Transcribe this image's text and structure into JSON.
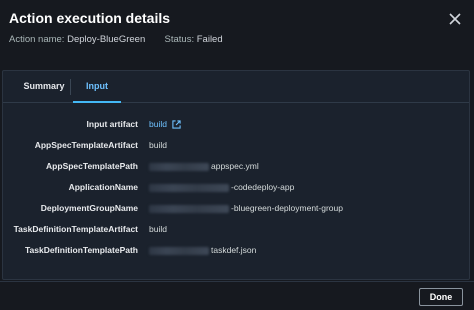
{
  "modal": {
    "title": "Action execution details",
    "action_name_label": "Action name:",
    "action_name_value": "Deploy-BlueGreen",
    "status_label": "Status:",
    "status_value": "Failed"
  },
  "tabs": [
    {
      "label": "Summary",
      "selected": false
    },
    {
      "label": "Input",
      "selected": true
    }
  ],
  "details": [
    {
      "label": "Input artifact",
      "value": "build",
      "link": true
    },
    {
      "label": "AppSpecTemplateArtifact",
      "value": "build"
    },
    {
      "label": "AppSpecTemplatePath",
      "value": "appspec.yml",
      "redacted_prefix": true
    },
    {
      "label": "ApplicationName",
      "value": "-codedeploy-app",
      "redacted_prefix": true
    },
    {
      "label": "DeploymentGroupName",
      "value": "-bluegreen-deployment-group",
      "redacted_prefix": true
    },
    {
      "label": "TaskDefinitionTemplateArtifact",
      "value": "build"
    },
    {
      "label": "TaskDefinitionTemplatePath",
      "value": "taskdef.json",
      "redacted_prefix": true
    }
  ],
  "footer": {
    "done_label": "Done"
  },
  "icons": {
    "close": "close-icon",
    "external": "external-link-icon"
  },
  "colors": {
    "accent": "#44b9f6",
    "link": "#6ec1ff"
  }
}
